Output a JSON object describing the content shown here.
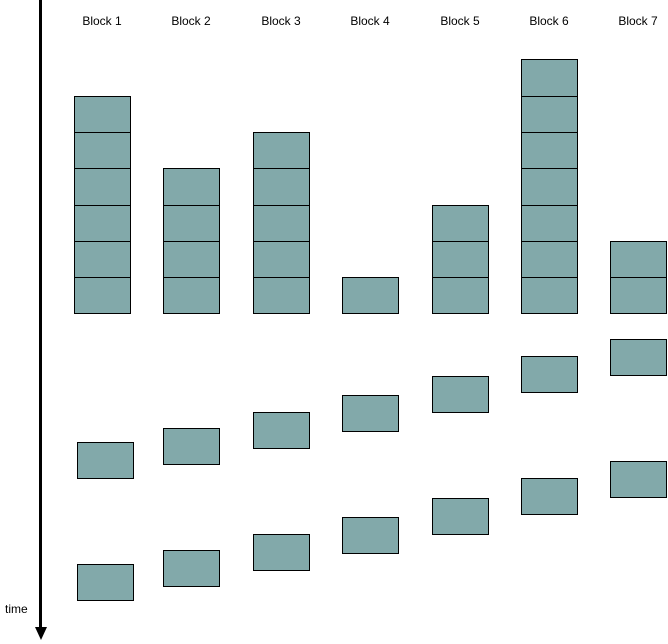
{
  "axis_label": "time",
  "box_color": "#82a9aa",
  "blocks": [
    {
      "label": "Block 1",
      "stack_count": 6
    },
    {
      "label": "Block 2",
      "stack_count": 4
    },
    {
      "label": "Block 3",
      "stack_count": 5
    },
    {
      "label": "Block 4",
      "stack_count": 1
    },
    {
      "label": "Block 5",
      "stack_count": 3
    },
    {
      "label": "Block 6",
      "stack_count": 7
    },
    {
      "label": "Block 7",
      "stack_count": 2
    }
  ]
}
